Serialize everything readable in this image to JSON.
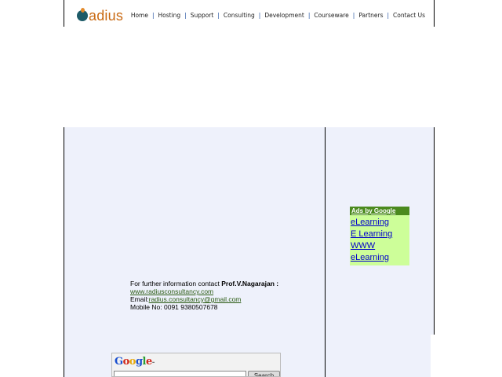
{
  "logo": {
    "text": "adius"
  },
  "nav": [
    "Home",
    "Hosting",
    "Support",
    "Consulting",
    "Development",
    "Courseware",
    "Partners",
    "Contact Us"
  ],
  "nav_separator": "|",
  "ads": {
    "header": "Ads by Google",
    "links": [
      "eLearning",
      "E Learning",
      "WWW eLearning"
    ]
  },
  "contact": {
    "intro": "For further information contact ",
    "name": "Prof.V.Nagarajan :",
    "website": "www.radiusconsultancy.com",
    "email_label": "Email:",
    "email": "radius.consultancy@gmail.com",
    "mobile": "Mobile No: 0091 9380507678"
  },
  "search": {
    "input_value": "",
    "button_label": "Search"
  },
  "colors": {
    "panel_bg": "#eef1fb",
    "ads_header_bg": "#4b8a1e",
    "ads_body_bg": "#cdfe99",
    "logo_orange": "#c96a13",
    "logo_teal": "#1d5b68"
  }
}
